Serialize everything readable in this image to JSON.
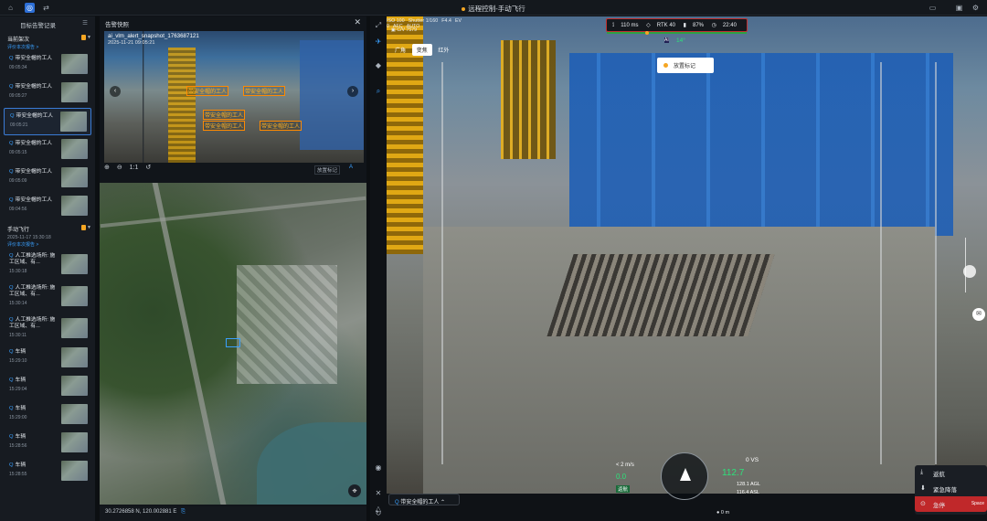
{
  "app": {
    "title": "远程控制-手动飞行"
  },
  "left_panel": {
    "header": "目标告警记录",
    "sections": [
      {
        "title": "当前架次",
        "link": "评价本次报告 >",
        "items": [
          {
            "label": "带安全帽的工人",
            "time": "09:05:34"
          },
          {
            "label": "带安全帽的工人",
            "time": "09:05:27"
          },
          {
            "label": "带安全帽的工人",
            "time": "09:05:21",
            "selected": true
          },
          {
            "label": "带安全帽的工人",
            "time": "09:05:15"
          },
          {
            "label": "带安全帽的工人",
            "time": "09:05:09"
          },
          {
            "label": "带安全帽的工人",
            "time": "09:04:56"
          }
        ]
      },
      {
        "title": "手动飞行",
        "meta": "2025-11-17 15:30:18",
        "link": "评价本次报告 >",
        "items": [
          {
            "label": "人工推选场所: 施工区域、有...",
            "time": "15:30:18"
          },
          {
            "label": "人工推选场所: 施工区域、有...",
            "time": "15:30:14"
          },
          {
            "label": "人工推选场所: 施工区域、有...",
            "time": "15:30:11"
          },
          {
            "label": "车辆",
            "time": "15:29:10"
          },
          {
            "label": "车辆",
            "time": "15:29:04"
          },
          {
            "label": "车辆",
            "time": "15:29:00"
          },
          {
            "label": "车辆",
            "time": "15:28:56"
          },
          {
            "label": "车辆",
            "time": "15:28:55"
          }
        ]
      }
    ]
  },
  "middle_panel": {
    "header": "告警快照",
    "snapshot": {
      "filename": "ai_vlm_alert_snapshot_1763687121",
      "datetime": "2025-11-21 09:05:21",
      "annotations": [
        "带安全帽的工人",
        "带安全帽的工人",
        "带安全帽的工人",
        "带安全帽的工人",
        "带安全帽的工人"
      ]
    },
    "tools": {
      "zoom_ratio": "1:1",
      "report_btn": "放置标记",
      "ai_btn": "A"
    },
    "coordinates": "30.2726858 N, 120.002881 E"
  },
  "video": {
    "osd": {
      "iso": "ISO 100",
      "shutter": "Shutter 1/160",
      "fnum": "F4.4",
      "ev": "EV 0",
      "afc": "AFC",
      "auto": "AUTO",
      "resolution": "C/V 7579"
    },
    "lens_tabs": [
      "广角",
      "变焦",
      "红外"
    ],
    "lens_active": 1,
    "status": {
      "latency": "110 ms",
      "rtk": "RTK 40",
      "battery": "87%",
      "flight_time": "22:40"
    },
    "yaw": "14°",
    "ai_label": "AI",
    "pin_label": "放置标记",
    "hud": {
      "vs": "0 VS",
      "altitude": "112.7",
      "agl": "128.1 AGL",
      "asl": "116.4 ASL",
      "hs": "< 2 m/s",
      "hs_value": "0.0",
      "rth": "返航"
    },
    "distance": "0 m",
    "alert_chip": "带安全帽的工人"
  },
  "commands": {
    "rth": "返航",
    "emergency": "紧急降落",
    "stop": "急停",
    "stop_key": "Space"
  }
}
